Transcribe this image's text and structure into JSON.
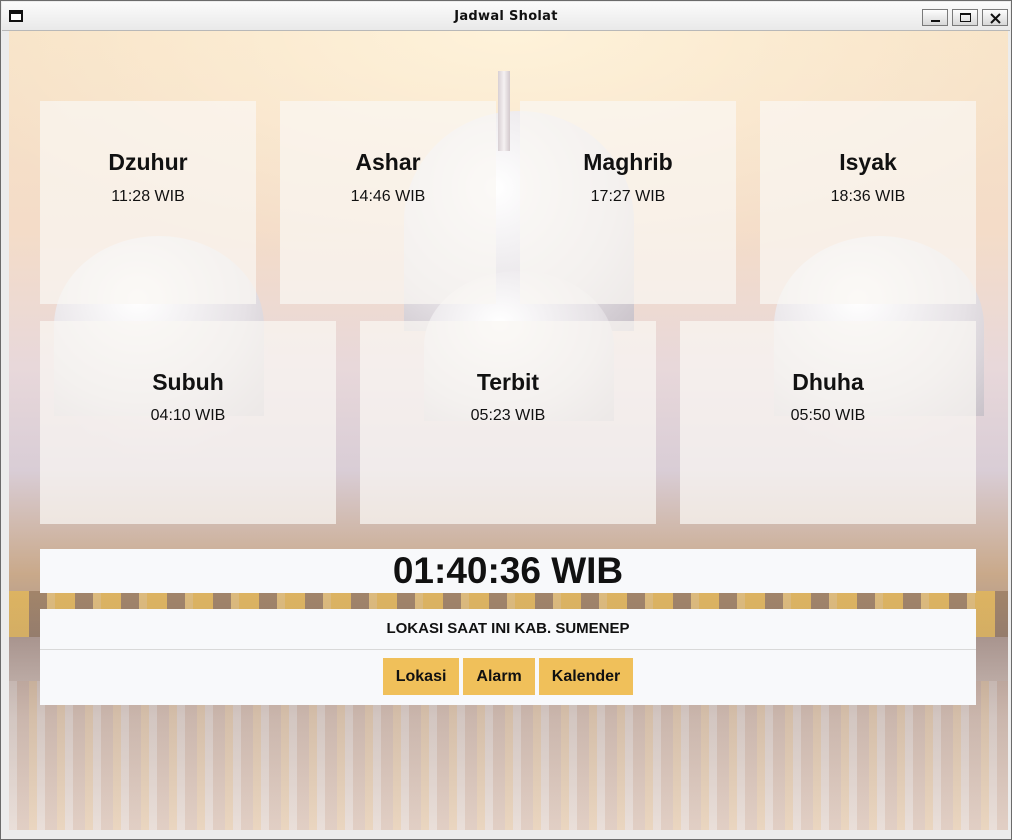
{
  "window": {
    "title": "Jadwal Sholat"
  },
  "prayers_top": [
    {
      "name": "Dzuhur",
      "time": "11:28 WIB"
    },
    {
      "name": "Ashar",
      "time": "14:46 WIB"
    },
    {
      "name": "Maghrib",
      "time": "17:27 WIB"
    },
    {
      "name": "Isyak",
      "time": "18:36 WIB"
    }
  ],
  "prayers_bottom": [
    {
      "name": "Subuh",
      "time": "04:10 WIB"
    },
    {
      "name": "Terbit",
      "time": "05:23 WIB"
    },
    {
      "name": "Dhuha",
      "time": "05:50 WIB"
    }
  ],
  "clock": "01:40:36 WIB",
  "location_text": "LOKASI SAAT INI KAB. SUMENEP",
  "buttons": {
    "lokasi": "Lokasi",
    "alarm": "Alarm",
    "kalender": "Kalender"
  },
  "colors": {
    "button_bg": "#f0c05a",
    "panel_bg": "#f8f9fb"
  }
}
